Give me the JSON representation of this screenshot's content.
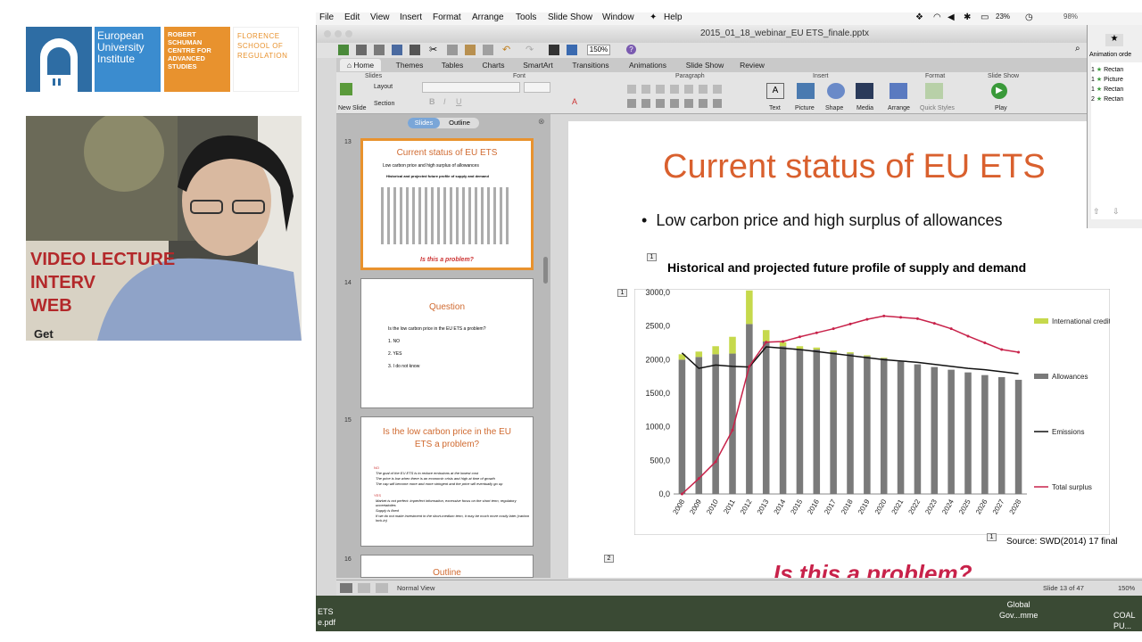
{
  "logos": {
    "eui": "European University Institute",
    "rsc": "ROBERT SCHUMAN CENTRE FOR ADVANCED STUDIES",
    "fsr": "FLORENCE SCHOOL OF REGULATION"
  },
  "webcam": {
    "poster_lines": [
      "VIDEO LECTURE",
      "INTERV",
      "WEB",
      "Get"
    ]
  },
  "menubar": {
    "items": [
      "File",
      "Edit",
      "View",
      "Insert",
      "Format",
      "Arrange",
      "Tools",
      "Slide Show",
      "Window",
      "Help"
    ],
    "battery": "23%",
    "percent2": "98%"
  },
  "window": {
    "title": "2015_01_18_webinar_EU ETS_finale.pptx",
    "zoom": "150%"
  },
  "ribbon": {
    "tabs": [
      "Home",
      "Themes",
      "Tables",
      "Charts",
      "SmartArt",
      "Transitions",
      "Animations",
      "Slide Show",
      "Review"
    ],
    "groups": {
      "slides": "Slides",
      "font": "Font",
      "paragraph": "Paragraph",
      "insert": "Insert",
      "format": "Format",
      "slideshow": "Slide Show"
    },
    "buttons": {
      "new_slide": "New Slide",
      "layout": "Layout",
      "section": "Section",
      "text": "Text",
      "picture": "Picture",
      "shape": "Shape",
      "media": "Media",
      "arrange": "Arrange",
      "quick_styles": "Quick Styles",
      "play": "Play"
    }
  },
  "slidespane": {
    "tab_slides": "Slides",
    "tab_outline": "Outline",
    "thumbs": [
      {
        "num": "13",
        "title": "Current status of EU ETS",
        "bullet": "Low carbon price and high surplus of allowances",
        "sub": "Historical and projected future profile of supply and demand",
        "footer": "Is this a problem?"
      },
      {
        "num": "14",
        "title": "Question",
        "q": "Is the low carbon price in the EU ETS a problem?",
        "opts": [
          "1.   NO",
          "2.   YES",
          "3.   I do not know"
        ]
      },
      {
        "num": "15",
        "title": "Is the low carbon price in the EU ETS a problem?",
        "no": "NO",
        "no_lines": [
          "The goal of the EU ETS is to reduce emissions at the lowest cost",
          "The price is low when there is an economic crisis and high at time of growth",
          "The cap will become more and more stringent and the price will eventually go up"
        ],
        "yes": "YES",
        "yes_lines": [
          "Market is not perfect: imperfect information, excessive focus on the short term, regulatory uncertainties",
          "Supply is fixed",
          "If we do not make investment in the short-medium term, it may be much more costly later (carbon lock-in)"
        ]
      },
      {
        "num": "16",
        "title": "Outline"
      }
    ]
  },
  "slide": {
    "title": "Current status of EU ETS",
    "bullet": "Low carbon price and high surplus of allowances",
    "subtitle": "Historical and projected future profile of supply and demand",
    "source": "Source: SWD(2014) 17 final",
    "bottom": "Is this a problem?",
    "marker1": "1",
    "marker2": "2"
  },
  "statusbar": {
    "view": "Normal View",
    "slide": "Slide 13 of 47",
    "zoom": "150%"
  },
  "animpane": {
    "header": "Animation orde",
    "items": [
      {
        "n": "1",
        "label": "Rectan"
      },
      {
        "n": "1",
        "label": "Picture"
      },
      {
        "n": "1",
        "label": "Rectan"
      },
      {
        "n": "2",
        "label": "Rectan"
      }
    ]
  },
  "desktop": {
    "left": [
      "ETS",
      "e.pdf"
    ],
    "middle": [
      "Global",
      "Gov...mme"
    ],
    "right": [
      "COAL",
      "PU..."
    ]
  },
  "chart_data": {
    "type": "bar",
    "categories": [
      "2008",
      "2009",
      "2010",
      "2011",
      "2012",
      "2013",
      "2014",
      "2015",
      "2016",
      "2017",
      "2018",
      "2019",
      "2020",
      "2021",
      "2022",
      "2023",
      "2024",
      "2025",
      "2026",
      "2027",
      "2028"
    ],
    "yticks": [
      "0,0",
      "500,0",
      "1000,0",
      "1500,0",
      "2000,0",
      "2500,0",
      "3000,0"
    ],
    "ylim": [
      0,
      3000
    ],
    "series": [
      {
        "name": "International credits",
        "kind": "stacked-bar",
        "color": "#c6d94c",
        "values": [
          80,
          80,
          120,
          250,
          500,
          170,
          60,
          40,
          30,
          25,
          20,
          15,
          10,
          0,
          0,
          0,
          0,
          0,
          0,
          0,
          0
        ]
      },
      {
        "name": "Allowances",
        "kind": "bar",
        "color": "#7a7a7a",
        "values": [
          2000,
          2040,
          2080,
          2090,
          2530,
          2270,
          2200,
          2160,
          2150,
          2110,
          2090,
          2050,
          2020,
          1970,
          1930,
          1890,
          1850,
          1810,
          1770,
          1740,
          1700
        ]
      },
      {
        "name": "Emissions",
        "kind": "line",
        "color": "#111111",
        "values": [
          2100,
          1870,
          1920,
          1900,
          1890,
          2190,
          2170,
          2150,
          2120,
          2090,
          2060,
          2030,
          2000,
          1980,
          1960,
          1930,
          1900,
          1870,
          1850,
          1820,
          1790
        ]
      },
      {
        "name": "Total surplus",
        "kind": "line",
        "color": "#c8224a",
        "values": [
          0,
          230,
          480,
          950,
          1900,
          2260,
          2270,
          2340,
          2400,
          2460,
          2530,
          2600,
          2650,
          2630,
          2610,
          2540,
          2460,
          2350,
          2250,
          2150,
          2110
        ]
      }
    ]
  }
}
